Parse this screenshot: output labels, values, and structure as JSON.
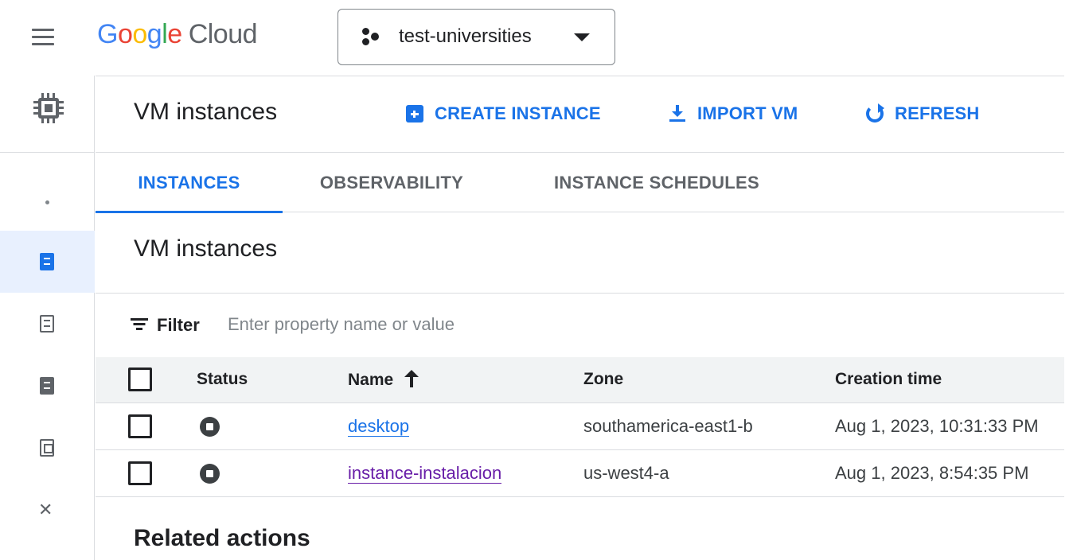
{
  "topbar": {
    "logo_letters": [
      "G",
      "o",
      "o",
      "g",
      "l",
      "e"
    ],
    "logo_suffix": "Cloud",
    "project_name": "test-universities"
  },
  "icons": {
    "menu": "hamburger-menu-icon",
    "project": "project-dots-icon",
    "caret": "caret-down-icon",
    "product": "compute-chip-icon",
    "create": "add-box-icon",
    "import": "download-icon",
    "refresh": "refresh-icon",
    "filter": "filter-list-icon",
    "sort": "arrow-up-icon",
    "status": "stopped-status-icon"
  },
  "header": {
    "title": "VM instances",
    "actions": {
      "create": "CREATE INSTANCE",
      "import": "IMPORT VM",
      "refresh": "REFRESH"
    }
  },
  "tabs": [
    {
      "label": "INSTANCES",
      "active": true
    },
    {
      "label": "OBSERVABILITY",
      "active": false
    },
    {
      "label": "INSTANCE SCHEDULES",
      "active": false
    }
  ],
  "section_title": "VM instances",
  "filter": {
    "label": "Filter",
    "placeholder": "Enter property name or value"
  },
  "table": {
    "columns": {
      "status": "Status",
      "name": "Name",
      "zone": "Zone",
      "creation_time": "Creation time"
    },
    "rows": [
      {
        "name": "desktop",
        "zone": "southamerica-east1-b",
        "creation_time": "Aug 1, 2023, 10:31:33 PM",
        "status": "stopped",
        "visited": false
      },
      {
        "name": "instance-instalacion",
        "zone": "us-west4-a",
        "creation_time": "Aug 1, 2023, 8:54:35 PM",
        "status": "stopped",
        "visited": true
      }
    ]
  },
  "related_actions": "Related actions",
  "colors": {
    "accent": "#1a73e8",
    "visited_link": "#681da8",
    "active_rail": "#e8f0fe",
    "table_header_bg": "#f1f3f4",
    "divider": "#dadce0"
  }
}
